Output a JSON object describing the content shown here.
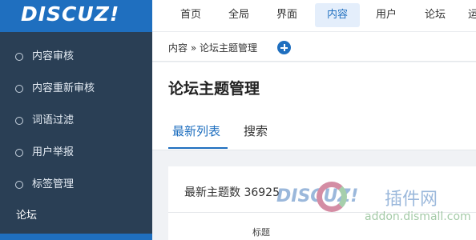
{
  "app": {
    "logo": "DISCUZ!"
  },
  "topnav": {
    "items": [
      {
        "label": "首页"
      },
      {
        "label": "全局"
      },
      {
        "label": "界面"
      },
      {
        "label": "内容",
        "active": true
      },
      {
        "label": "用户"
      },
      {
        "label": "论坛"
      },
      {
        "label": "运"
      }
    ]
  },
  "sidebar": {
    "items": [
      {
        "label": "内容审核"
      },
      {
        "label": "内容重新审核"
      },
      {
        "label": "词语过滤"
      },
      {
        "label": "用户举报"
      },
      {
        "label": "标签管理"
      }
    ],
    "group_label": "论坛"
  },
  "breadcrumb": {
    "text": "内容 » 论坛主题管理"
  },
  "page": {
    "title": "论坛主题管理",
    "tabs": [
      {
        "label": "最新列表",
        "active": true
      },
      {
        "label": "搜索"
      }
    ],
    "count_text": "最新主题数 36925",
    "table": {
      "columns": [
        "标题"
      ]
    }
  },
  "watermark": {
    "text": "DISCUZ!",
    "cn": "插件网",
    "url": "addon.dismall.com"
  },
  "colors": {
    "accent": "#1f6fbf",
    "sidebar_bg": "#2a3f55"
  }
}
